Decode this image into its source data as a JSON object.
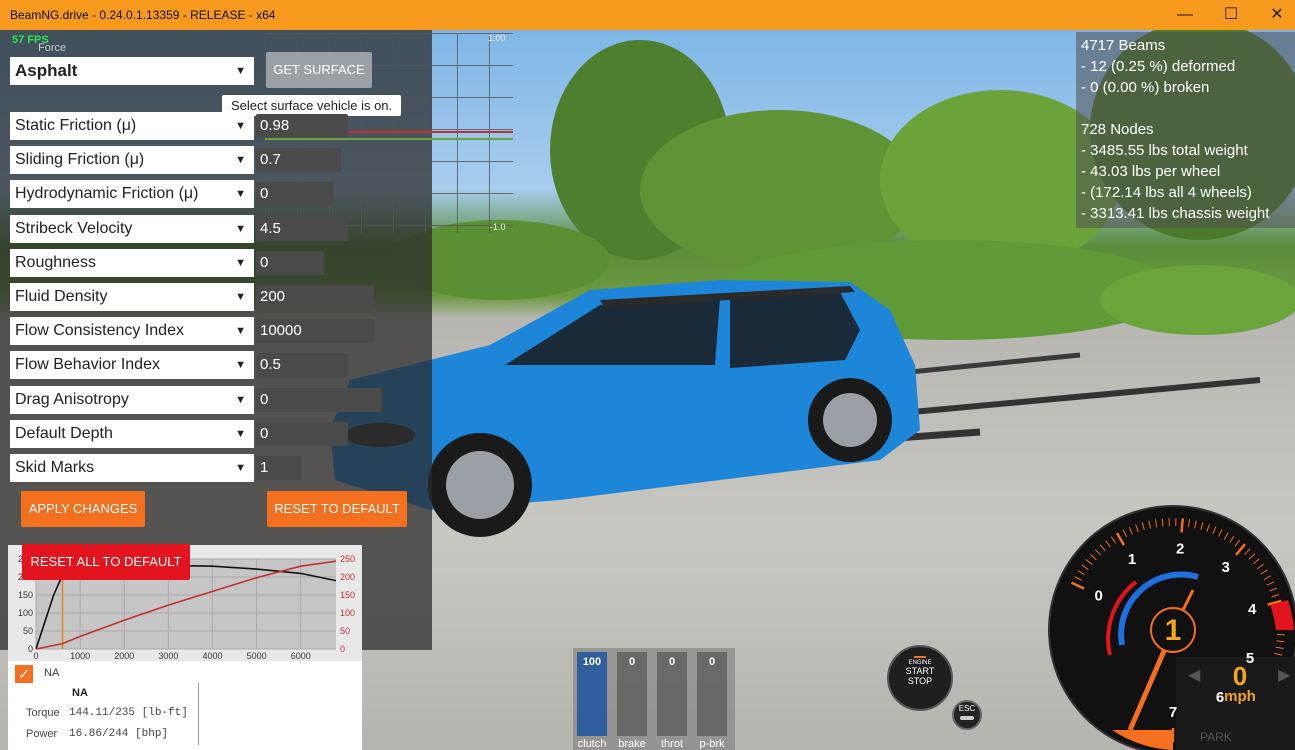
{
  "window": {
    "title": "BeamNG.drive - 0.24.0.1.13359 - RELEASE - x64",
    "minimize": "—",
    "maximize": "☐",
    "close": "✕"
  },
  "hud": {
    "fps": "57 FPS",
    "force_label": "Force"
  },
  "surface": {
    "selected": "Asphalt",
    "get_surface_label": "GET SURFACE",
    "tooltip": "Select surface vehicle is on.",
    "grid_max": "1.00",
    "grid_min": "-1.0",
    "params": [
      {
        "label": "Static Friction (μ)",
        "value": "0.98"
      },
      {
        "label": "Sliding Friction (μ)",
        "value": "0.7"
      },
      {
        "label": "Hydrodynamic Friction (μ)",
        "value": "0"
      },
      {
        "label": "Stribeck Velocity",
        "value": "4.5"
      },
      {
        "label": "Roughness",
        "value": "0"
      },
      {
        "label": "Fluid Density",
        "value": "200"
      },
      {
        "label": "Flow Consistency Index",
        "value": "10000"
      },
      {
        "label": "Flow Behavior Index",
        "value": "0.5"
      },
      {
        "label": "Drag Anisotropy",
        "value": "0"
      },
      {
        "label": "Default Depth",
        "value": "0"
      },
      {
        "label": "Skid Marks",
        "value": "1"
      }
    ],
    "apply_label": "APPLY CHANGES",
    "reset_label": "RESET TO DEFAULT",
    "reset_all_label": "RESET ALL TO DEFAULT"
  },
  "stats": {
    "beams": "4717 Beams",
    "deformed": "- 12 (0.25 %) deformed",
    "broken": "- 0 (0.00 %) broken",
    "nodes": "728 Nodes",
    "total_weight": "- 3485.55 lbs total weight",
    "per_wheel": "- 43.03 lbs per wheel",
    "all_wheels": "- (172.14 lbs all 4 wheels)",
    "chassis": "- 3313.41 lbs chassis weight"
  },
  "chart_data": {
    "type": "line",
    "x_ticks": [
      "0",
      "1000",
      "2000",
      "3000",
      "4000",
      "5000",
      "6000"
    ],
    "y_left_ticks": [
      "0",
      "50",
      "100",
      "150",
      "200",
      "250"
    ],
    "y_right_ticks": [
      "0",
      "50",
      "100",
      "150",
      "200",
      "250"
    ],
    "xlim": [
      0,
      6800
    ],
    "ylim": [
      0,
      250
    ],
    "series": [
      {
        "color": "#111111",
        "x": [
          0,
          400,
          600,
          800,
          1200,
          2000,
          3000,
          4000,
          5000,
          6000,
          6800
        ],
        "y": [
          0,
          150,
          205,
          220,
          228,
          232,
          232,
          230,
          222,
          210,
          190
        ]
      },
      {
        "color": "#c0312b",
        "x": [
          0,
          600,
          1000,
          2000,
          3000,
          4000,
          5000,
          6000,
          6800
        ],
        "y": [
          0,
          15,
          35,
          80,
          122,
          160,
          198,
          230,
          244
        ]
      }
    ],
    "marker_x": 600
  },
  "legend": {
    "checkbox_label": "NA",
    "name": "NA",
    "torque_label": "Torque",
    "torque_value": "144.11/235 [lb-ft]",
    "power_label": "Power",
    "power_value": "16.86/244  [bhp]"
  },
  "pedals": {
    "items": [
      {
        "label": "clutch",
        "value": "100",
        "level": 1.0
      },
      {
        "label": "brake",
        "value": "0",
        "level": 0
      },
      {
        "label": "throt",
        "value": "0",
        "level": 0
      },
      {
        "label": "p-brk",
        "value": "0",
        "level": 0
      }
    ]
  },
  "engine_button": {
    "line1": "ENGINE",
    "line2": "START",
    "line3": "STOP"
  },
  "esc_label": "ESC",
  "gauge": {
    "gear": "1",
    "speed": "0",
    "unit": "mph",
    "park": "PARK",
    "rpm_labels": [
      "0",
      "1",
      "2",
      "3",
      "4",
      "5",
      "6",
      "7"
    ]
  }
}
